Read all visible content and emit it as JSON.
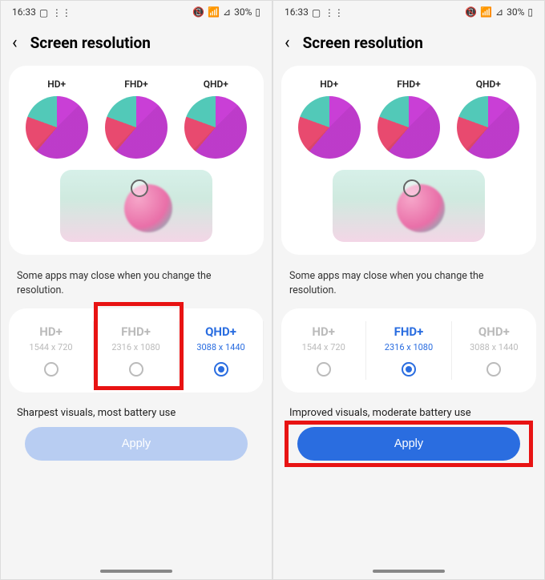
{
  "screens": [
    {
      "status": {
        "time": "16:33",
        "battery": "30%"
      },
      "title": "Screen resolution",
      "previewLabels": [
        "HD+",
        "FHD+",
        "QHD+"
      ],
      "warning": "Some apps may close when you change the resolution.",
      "options": [
        {
          "name": "HD+",
          "dim": "1544 x 720",
          "selected": false
        },
        {
          "name": "FHD+",
          "dim": "2316 x 1080",
          "selected": false
        },
        {
          "name": "QHD+",
          "dim": "3088 x 1440",
          "selected": true
        }
      ],
      "description": "Sharpest visuals, most battery use",
      "apply": {
        "label": "Apply",
        "enabled": false
      },
      "highlight": "option-1"
    },
    {
      "status": {
        "time": "16:33",
        "battery": "30%"
      },
      "title": "Screen resolution",
      "previewLabels": [
        "HD+",
        "FHD+",
        "QHD+"
      ],
      "warning": "Some apps may close when you change the resolution.",
      "options": [
        {
          "name": "HD+",
          "dim": "1544 x 720",
          "selected": false
        },
        {
          "name": "FHD+",
          "dim": "2316 x 1080",
          "selected": true
        },
        {
          "name": "QHD+",
          "dim": "3088 x 1440",
          "selected": false
        }
      ],
      "description": "Improved visuals, moderate battery use",
      "apply": {
        "label": "Apply",
        "enabled": true
      },
      "highlight": "apply"
    }
  ]
}
